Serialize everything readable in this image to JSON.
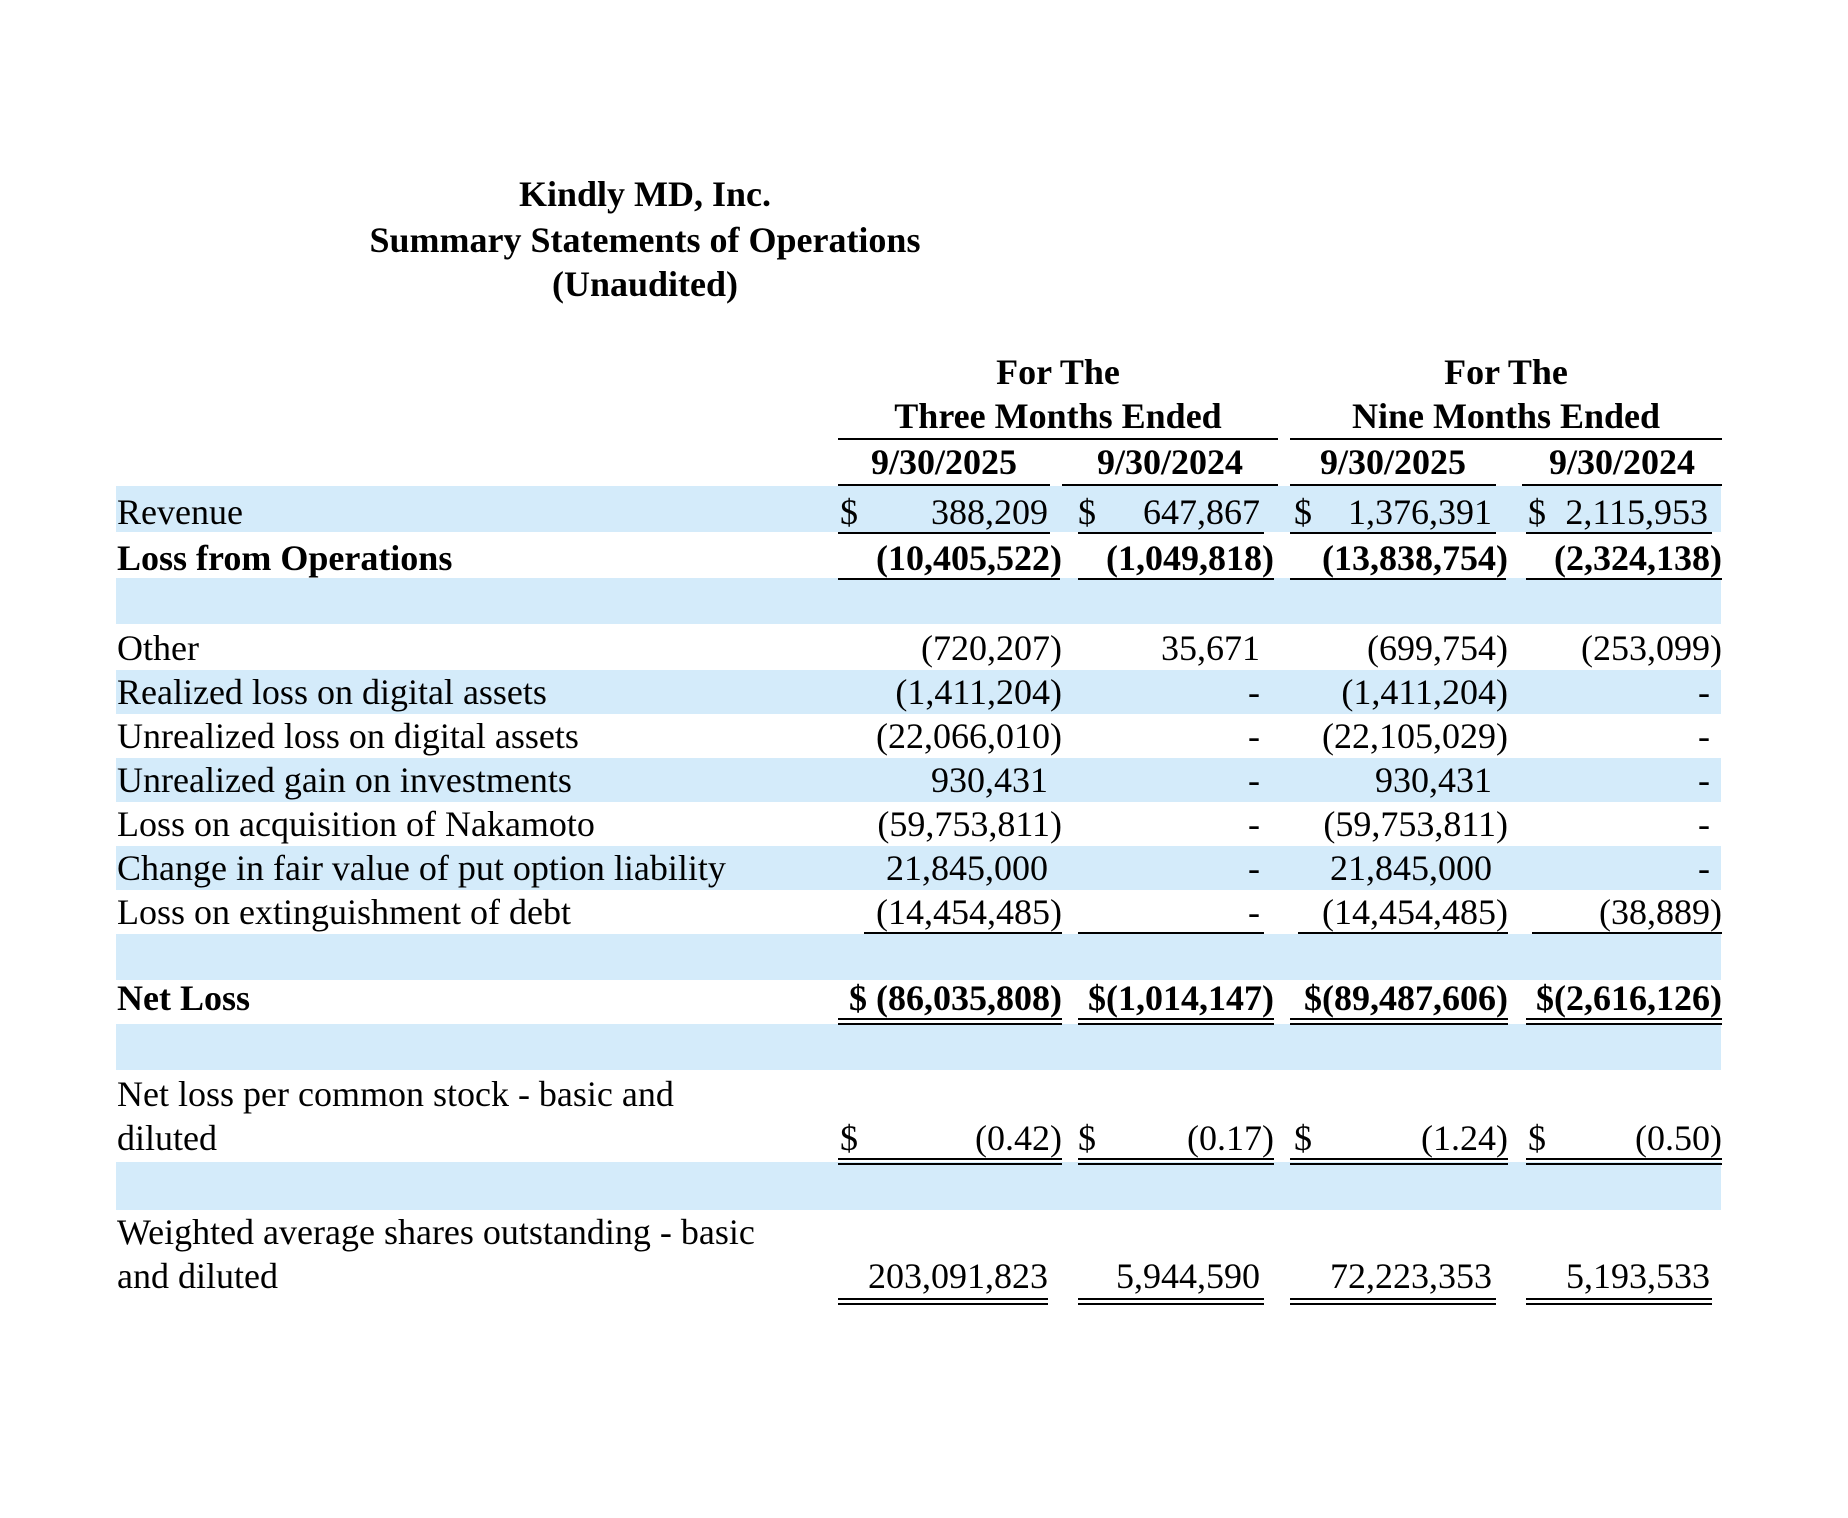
{
  "company": "Kindly MD, Inc.",
  "statement_title": "Summary Statements of Operations",
  "audit_status": "(Unaudited)",
  "column_groups": [
    {
      "line1": "For The",
      "line2": "Three Months Ended"
    },
    {
      "line1": "For The",
      "line2": "Nine Months Ended"
    }
  ],
  "columns": [
    "9/30/2025",
    "9/30/2024",
    "9/30/2025",
    "9/30/2024"
  ],
  "rows": [
    {
      "label": "Revenue",
      "values": [
        "$",
        "388,209",
        "$",
        "647,867",
        "$",
        "1,376,391",
        "$",
        "2,115,953"
      ]
    },
    {
      "label": "Loss from Operations",
      "values": [
        "(10,405,522)",
        "(1,049,818)",
        "(13,838,754)",
        "(2,324,138)"
      ]
    },
    {
      "label": "Other",
      "values": [
        "(720,207)",
        "35,671",
        "(699,754)",
        "(253,099)"
      ]
    },
    {
      "label": "Realized loss on digital assets",
      "values": [
        "(1,411,204)",
        "-",
        "(1,411,204)",
        "-"
      ]
    },
    {
      "label": "Unrealized loss on digital assets",
      "values": [
        "(22,066,010)",
        "-",
        "(22,105,029)",
        "-"
      ]
    },
    {
      "label": "Unrealized gain on investments",
      "values": [
        "930,431",
        "-",
        "930,431",
        "-"
      ]
    },
    {
      "label": "Loss on acquisition of Nakamoto",
      "values": [
        "(59,753,811)",
        "-",
        "(59,753,811)",
        "-"
      ]
    },
    {
      "label": "Change in fair value of put option liability",
      "values": [
        "21,845,000",
        "-",
        "21,845,000",
        "-"
      ]
    },
    {
      "label": "Loss on extinguishment of debt",
      "values": [
        "(14,454,485)",
        "-",
        "(14,454,485)",
        "(38,889)"
      ]
    },
    {
      "label": "Net Loss",
      "values": [
        "$ (86,035,808)",
        "$(1,014,147)",
        "$(89,487,606)",
        "$(2,616,126)"
      ]
    },
    {
      "label_line1": "Net loss per common stock - basic and",
      "label_line2": "diluted",
      "values": [
        "$",
        "(0.42)",
        "$",
        "(0.17)",
        "$",
        "(1.24)",
        "$",
        "(0.50)"
      ]
    },
    {
      "label_line1": "Weighted average shares outstanding - basic",
      "label_line2": "and diluted",
      "values": [
        "203,091,823",
        "5,944,590",
        "72,223,353",
        "5,193,533"
      ]
    }
  ]
}
